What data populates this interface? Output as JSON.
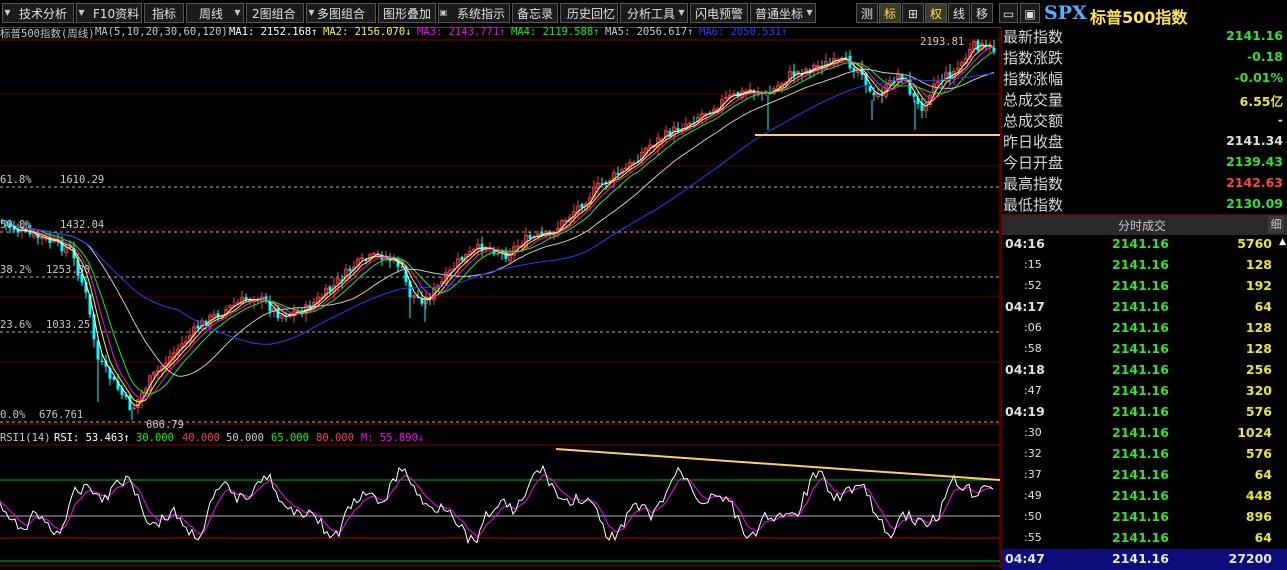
{
  "toolbar": {
    "buttons": [
      "技术分析",
      "F10资料",
      "指标",
      "周线",
      "2图组合",
      "多图组合",
      "图形叠加",
      "系统指示",
      "备忘录",
      "历史回忆",
      "分析工具",
      "闪电预警",
      "普通坐标"
    ],
    "right_buttons": [
      "测",
      "标",
      "⊞",
      "权",
      "线",
      "移"
    ]
  },
  "symbol": {
    "code": "SPX",
    "name": "标普500指数"
  },
  "chart": {
    "title_label": "标普500指数(周线)",
    "ma_legend": {
      "params": "MA(5,10,20,30,60,120)",
      "ma1": "MA1: 2152.168↑",
      "ma2": "MA2: 2156.070↓",
      "ma3": "MA3: 2143.771↑",
      "ma4": "MA4: 2119.588↑",
      "ma5": "MA5: 2056.617↑",
      "ma6": "MA6: 2050.531↑"
    },
    "fib_labels": [
      {
        "pct": "61.8%",
        "value": "1610.29"
      },
      {
        "pct": "50.0%",
        "value": "1432.04"
      },
      {
        "pct": "38.2%",
        "value": "1253.80"
      },
      {
        "pct": "23.6%",
        "value": "1033.25"
      },
      {
        "pct": "0.0%",
        "value": "676.761"
      }
    ],
    "high_label": "2193.81",
    "low_label": "666.79",
    "rsi_legend": {
      "name": "RSI1(14)",
      "rsi": "RSI: 53.463↑",
      "l1": "30.000",
      "l2": "40.000",
      "l3": "50.000",
      "l4": "65.000",
      "l5": "80.000",
      "m": "M: 55.890↓"
    },
    "colors": {
      "up": "#ff3b3b",
      "down": "#00ffff",
      "ma1": "#ffffff",
      "ma2": "#ffff00",
      "ma3": "#ff00ff",
      "ma4": "#00ff00",
      "ma5": "#c8c8c8",
      "ma6": "#2040ff",
      "trend": "#ffd060"
    }
  },
  "quote": {
    "items": [
      {
        "label": "最新指数",
        "value": "2141.16",
        "color": "#32e232"
      },
      {
        "label": "指数涨跌",
        "value": "-0.18",
        "color": "#32e232"
      },
      {
        "label": "指数涨幅",
        "value": "-0.01%",
        "color": "#32e232"
      },
      {
        "label": "总成交量",
        "value": "6.55亿",
        "color": "#e8e832"
      },
      {
        "label": "总成交额",
        "value": "-",
        "color": "#e8e832"
      },
      {
        "label": "昨日收盘",
        "value": "2141.34",
        "color": "#e0e0e0"
      },
      {
        "label": "今日开盘",
        "value": "2139.43",
        "color": "#32e232"
      },
      {
        "label": "最高指数",
        "value": "2142.63",
        "color": "#ff4444"
      },
      {
        "label": "最低指数",
        "value": "2130.09",
        "color": "#32e232"
      }
    ]
  },
  "ticks": {
    "header": "分时成交",
    "detail_label": "细",
    "rows": [
      {
        "time": "04:16",
        "price": "2141.16",
        "vol": "5760",
        "major": true
      },
      {
        "time": ":15",
        "price": "2141.16",
        "vol": "128",
        "major": false
      },
      {
        "time": ":52",
        "price": "2141.16",
        "vol": "192",
        "major": false
      },
      {
        "time": "04:17",
        "price": "2141.16",
        "vol": "64",
        "major": true
      },
      {
        "time": ":06",
        "price": "2141.16",
        "vol": "128",
        "major": false
      },
      {
        "time": ":58",
        "price": "2141.16",
        "vol": "128",
        "major": false
      },
      {
        "time": "04:18",
        "price": "2141.16",
        "vol": "256",
        "major": true
      },
      {
        "time": ":47",
        "price": "2141.16",
        "vol": "320",
        "major": false
      },
      {
        "time": "04:19",
        "price": "2141.16",
        "vol": "576",
        "major": true
      },
      {
        "time": ":30",
        "price": "2141.16",
        "vol": "1024",
        "major": false
      },
      {
        "time": ":32",
        "price": "2141.16",
        "vol": "576",
        "major": false
      },
      {
        "time": ":37",
        "price": "2141.16",
        "vol": "64",
        "major": false
      },
      {
        "time": ":49",
        "price": "2141.16",
        "vol": "448",
        "major": false
      },
      {
        "time": ":50",
        "price": "2141.16",
        "vol": "896",
        "major": false
      },
      {
        "time": ":55",
        "price": "2141.16",
        "vol": "64",
        "major": false
      },
      {
        "time": "04:47",
        "price": "2141.16",
        "vol": "27200",
        "major": true
      }
    ]
  }
}
